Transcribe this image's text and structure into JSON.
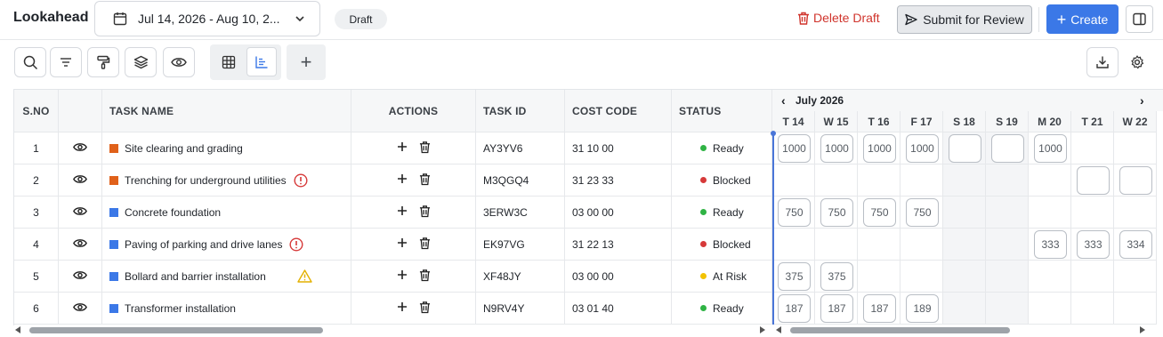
{
  "header": {
    "title": "Lookahead",
    "date_range": "Jul 14, 2026 - Aug 10, 2...",
    "status_badge": "Draft",
    "delete_label": "Delete Draft",
    "submit_label": "Submit for Review",
    "create_label": "Create"
  },
  "toolbar": {
    "icons": [
      "search-icon",
      "filter-icon",
      "paint-roller-icon",
      "layers-icon",
      "eye-icon",
      "table-view-icon",
      "gantt-view-icon",
      "plus-icon",
      "download-icon",
      "gear-icon"
    ],
    "add_label": "+"
  },
  "columns": {
    "sno": "S.NO",
    "task_name": "TASK NAME",
    "actions": "ACTIONS",
    "task_id": "TASK ID",
    "cost_code": "COST CODE",
    "status": "STATUS"
  },
  "calendar": {
    "month": "July 2026",
    "prev": "‹",
    "next": "›",
    "days": [
      "T 14",
      "W 15",
      "T 16",
      "F 17",
      "S 18",
      "S 19",
      "M 20",
      "T 21",
      "W 22"
    ]
  },
  "rows": [
    {
      "sno": "1",
      "name": "Site clearing and grading",
      "color": "#e0611a",
      "flag": "",
      "task_id": "AY3YV6",
      "cost_code": "31 10 00",
      "status": "Ready",
      "status_color": "#2fb344",
      "hours": [
        "1000",
        "1000",
        "1000",
        "1000",
        "",
        "",
        "1000",
        null,
        null
      ]
    },
    {
      "sno": "2",
      "name": "Trenching for underground utilities",
      "color": "#e0611a",
      "flag": "error",
      "task_id": "M3QGQ4",
      "cost_code": "31 23 33",
      "status": "Blocked",
      "status_color": "#d63939",
      "hours": [
        null,
        null,
        null,
        null,
        null,
        null,
        null,
        "",
        ""
      ]
    },
    {
      "sno": "3",
      "name": "Concrete foundation",
      "color": "#3b78e7",
      "flag": "",
      "task_id": "3ERW3C",
      "cost_code": "03 00 00",
      "status": "Ready",
      "status_color": "#2fb344",
      "hours": [
        "750",
        "750",
        "750",
        "750",
        null,
        null,
        null,
        null,
        null
      ]
    },
    {
      "sno": "4",
      "name": "Paving of parking and drive lanes",
      "color": "#3b78e7",
      "flag": "error",
      "task_id": "EK97VG",
      "cost_code": "31 22 13",
      "status": "Blocked",
      "status_color": "#d63939",
      "hours": [
        null,
        null,
        null,
        null,
        null,
        null,
        "333",
        "333",
        "334"
      ]
    },
    {
      "sno": "5",
      "name": "Bollard and barrier installation",
      "color": "#3b78e7",
      "flag": "warning",
      "task_id": "XF48JY",
      "cost_code": "03 00 00",
      "status": "At Risk",
      "status_color": "#f2c200",
      "hours": [
        "375",
        "375",
        null,
        null,
        null,
        null,
        null,
        null,
        null
      ]
    },
    {
      "sno": "6",
      "name": "Transformer installation",
      "color": "#3b78e7",
      "flag": "",
      "task_id": "N9RV4Y",
      "cost_code": "03 01 40",
      "status": "Ready",
      "status_color": "#2fb344",
      "hours": [
        "187",
        "187",
        "187",
        "189",
        null,
        null,
        null,
        null,
        null
      ]
    }
  ]
}
